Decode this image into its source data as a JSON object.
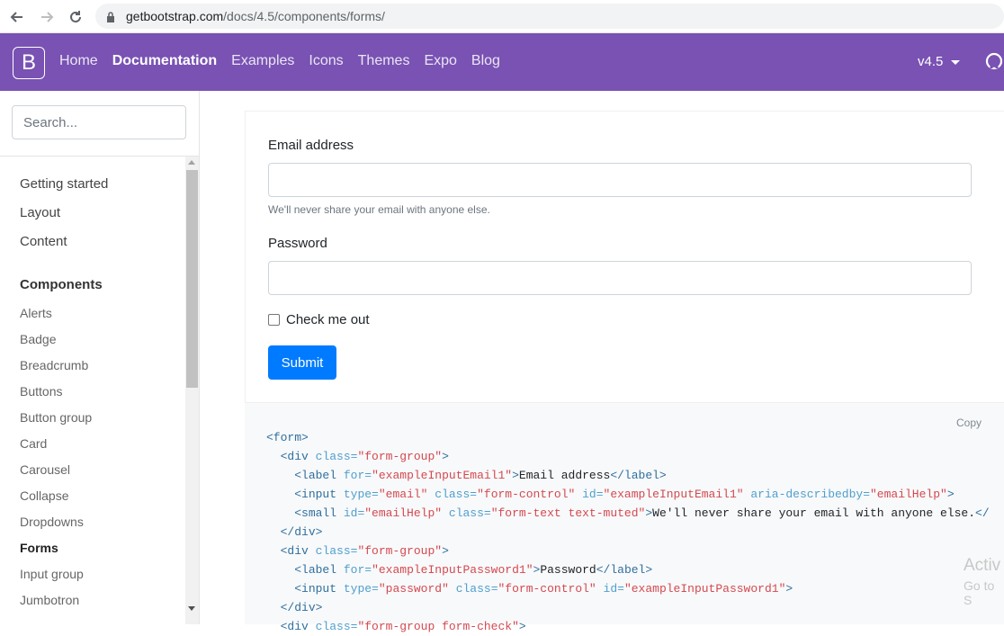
{
  "browser": {
    "url_host": "getbootstrap.com",
    "url_path": "/docs/4.5/components/forms/"
  },
  "navbar": {
    "brand": "B",
    "links": [
      "Home",
      "Documentation",
      "Examples",
      "Icons",
      "Themes",
      "Expo",
      "Blog"
    ],
    "active_link": "Documentation",
    "version": "v4.5",
    "brand_color": "#7952b3"
  },
  "sidebar": {
    "search_placeholder": "Search...",
    "sections": [
      "Getting started",
      "Layout",
      "Content"
    ],
    "components_heading": "Components",
    "component_items": [
      "Alerts",
      "Badge",
      "Breadcrumb",
      "Buttons",
      "Button group",
      "Card",
      "Carousel",
      "Collapse",
      "Dropdowns",
      "Forms",
      "Input group",
      "Jumbotron"
    ],
    "current_item": "Forms"
  },
  "form": {
    "email_label": "Email address",
    "email_help": "We'll never share your email with anyone else.",
    "password_label": "Password",
    "check_label": "Check me out",
    "submit_label": "Submit",
    "submit_color": "#007bff"
  },
  "code": {
    "copy_label": "Copy"
  },
  "watermark": {
    "line1": "Activ",
    "line2": "Go to S"
  }
}
